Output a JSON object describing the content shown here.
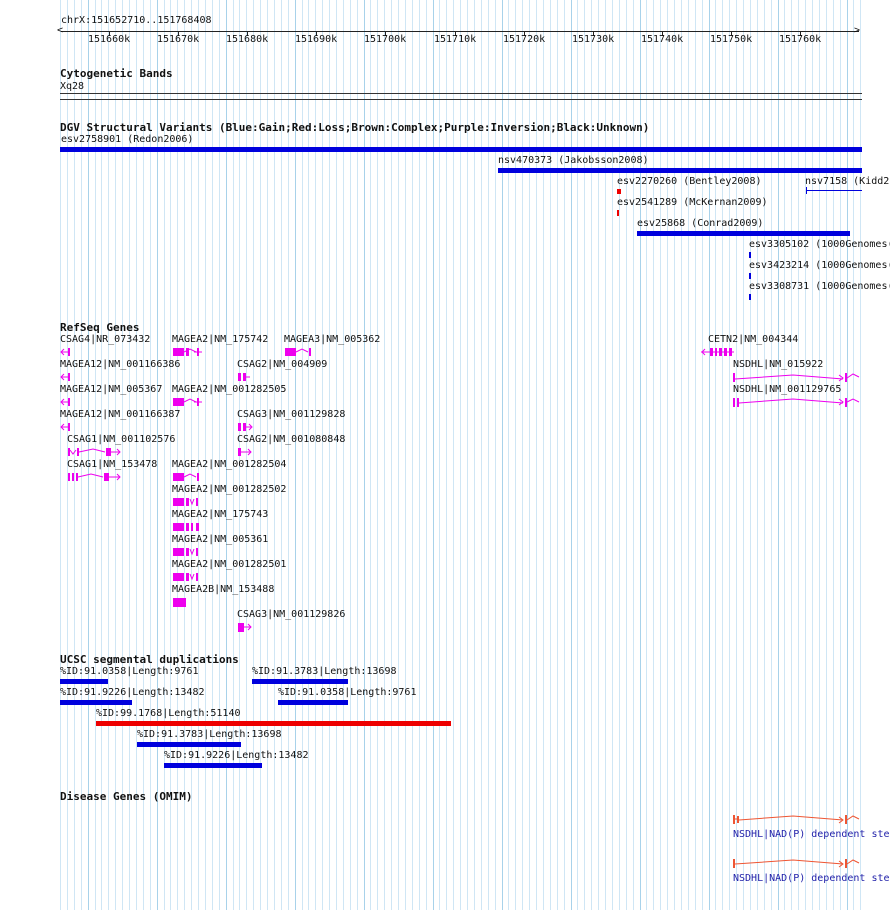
{
  "colors": {
    "gain": "#0000dd",
    "loss": "#ee0000",
    "gene": "#ee00ee",
    "disease": "#ee5533",
    "disease_text": "#2222aa",
    "dup_blue": "#0000dd",
    "dup_red": "#ee0000"
  },
  "ruler": {
    "coord": "chrX:151652710..151768408",
    "ticks": [
      "151660k",
      "151670k",
      "151680k",
      "151690k",
      "151700k",
      "151710k",
      "151720k",
      "151730k",
      "151740k",
      "151750k",
      "151760k"
    ]
  },
  "tracks": {
    "cytoband": {
      "title": "Cytogenetic Bands",
      "band": "Xq28"
    },
    "dgv": {
      "title": "DGV Structural Variants (Blue:Gain;Red:Loss;Brown:Complex;Purple:Inversion;Black:Unknown)",
      "items": [
        {
          "label": "esv2758901 (Redon2006)",
          "type": "gain"
        },
        {
          "label": "nsv470373 (Jakobsson2008)",
          "type": "gain"
        },
        {
          "label": "esv2270260 (Bentley2008)",
          "type": "loss"
        },
        {
          "label": "nsv7158 (Kidd2",
          "type": "gain"
        },
        {
          "label": "esv2541289 (McKernan2009)",
          "type": "loss"
        },
        {
          "label": "esv25868 (Conrad2009)",
          "type": "gain"
        },
        {
          "label": "esv3305102 (1000Genomes(",
          "type": "gain"
        },
        {
          "label": "esv3423214 (1000Genomes(",
          "type": "gain"
        },
        {
          "label": "esv3308731 (1000Genomes(",
          "type": "gain"
        }
      ]
    },
    "refseq": {
      "title": "RefSeq Genes",
      "genes": [
        "CSAG4|NR_073432",
        "MAGEA2|NM_175742",
        "MAGEA3|NM_005362",
        "CETN2|NM_004344",
        "MAGEA12|NM_001166386",
        "CSAG2|NM_004909",
        "NSDHL|NM_015922",
        "MAGEA12|NM_005367",
        "MAGEA2|NM_001282505",
        "NSDHL|NM_001129765",
        "MAGEA12|NM_001166387",
        "CSAG3|NM_001129828",
        "CSAG1|NM_001102576",
        "CSAG2|NM_001080848",
        "CSAG1|NM_153478",
        "MAGEA2|NM_001282504",
        "MAGEA2|NM_001282502",
        "MAGEA2|NM_175743",
        "MAGEA2|NM_005361",
        "MAGEA2|NM_001282501",
        "MAGEA2B|NM_153488",
        "CSAG3|NM_001129826"
      ]
    },
    "segdup": {
      "title": "UCSC segmental duplications",
      "items": [
        {
          "label": "%ID:91.0358|Length:9761",
          "type": "dup_blue"
        },
        {
          "label": "%ID:91.3783|Length:13698",
          "type": "dup_blue"
        },
        {
          "label": "%ID:91.9226|Length:13482",
          "type": "dup_blue"
        },
        {
          "label": "%ID:91.0358|Length:9761",
          "type": "dup_blue"
        },
        {
          "label": "%ID:99.1768|Length:51140",
          "type": "dup_red"
        },
        {
          "label": "%ID:91.3783|Length:13698",
          "type": "dup_blue"
        },
        {
          "label": "%ID:91.9226|Length:13482",
          "type": "dup_blue"
        }
      ]
    },
    "omim": {
      "title": "Disease Genes (OMIM)",
      "items": [
        "NSDHL|NAD(P) dependent ste",
        "NSDHL|NAD(P) dependent ste"
      ]
    }
  }
}
